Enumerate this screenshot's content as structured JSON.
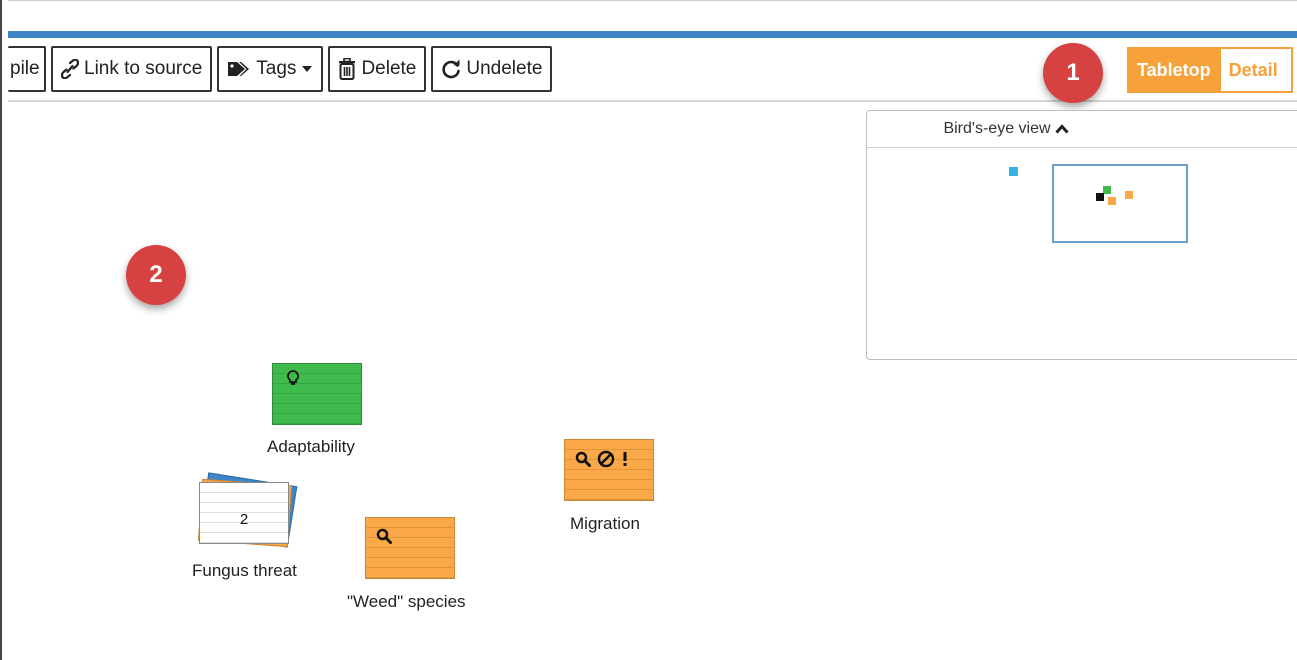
{
  "toolbar": {
    "pile_label": "pile",
    "link_label": "Link to source",
    "tags_label": "Tags",
    "delete_label": "Delete",
    "undelete_label": "Undelete"
  },
  "view_toggle": {
    "tabletop_label": "Tabletop",
    "detail_label": "Detail",
    "active": "Tabletop"
  },
  "badges": {
    "one": "1",
    "two": "2"
  },
  "birdseye": {
    "title": "Bird's-eye view"
  },
  "cards": {
    "adaptability": {
      "label": "Adaptability",
      "color": "#3ebb4c",
      "icons": [
        "lightbulb-icon"
      ]
    },
    "fungus_threat": {
      "label": "Fungus threat",
      "pile_count": "2",
      "color": "#ffffff"
    },
    "weed_species": {
      "label": "\"Weed\" species",
      "color": "#fba948",
      "icons": [
        "search-icon"
      ]
    },
    "migration": {
      "label": "Migration",
      "color": "#fba948",
      "icons": [
        "search-icon",
        "ban-icon",
        "exclamation-icon"
      ]
    }
  },
  "colors": {
    "accent": "#f7a13a",
    "brand_blue": "#3d85c6",
    "badge_red": "#d64242"
  }
}
